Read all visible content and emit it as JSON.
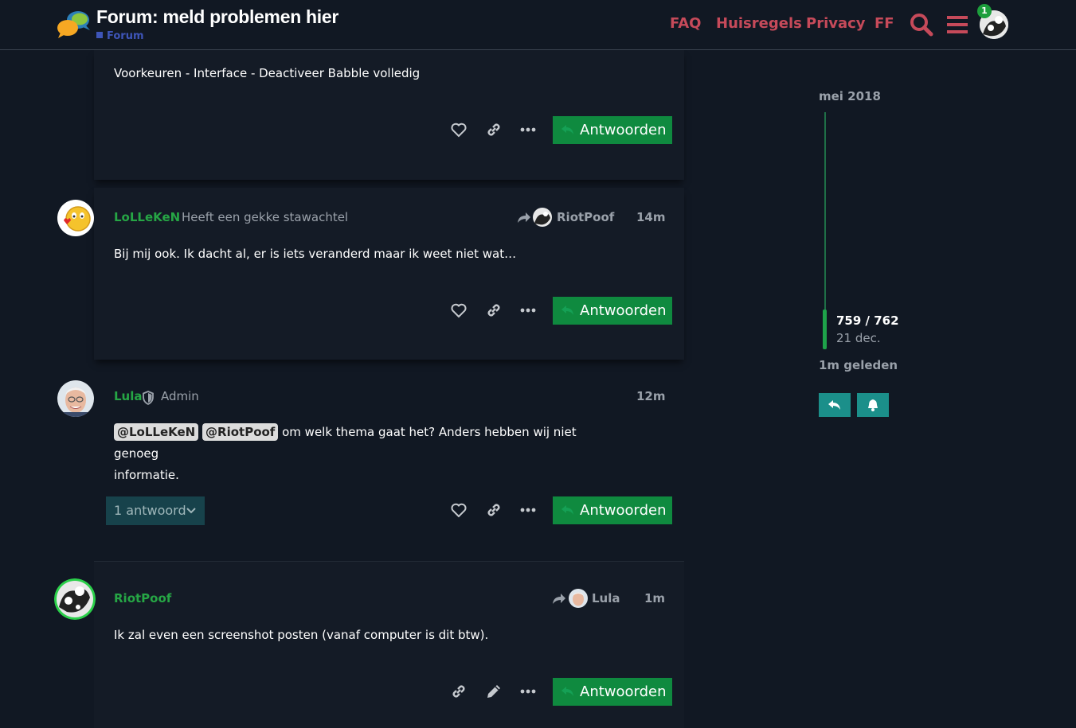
{
  "header": {
    "title": "Forum: meld problemen hier",
    "category": "Forum",
    "nav": [
      "FAQ",
      "Huisregels",
      "Privacy",
      "FF"
    ],
    "notification_count": "1",
    "accent_color": "#c64a5a"
  },
  "posts": [
    {
      "body": "Voorkeuren - Interface - Deactiveer Babble volledig",
      "reply_label": "Antwoorden"
    },
    {
      "username": "LoLLeKeN",
      "user_title": "Heeft een gekke stawachtel",
      "reply_to": "RiotPoof",
      "time": "14m",
      "body": "Bij mij ook. Ik dacht al, er is iets veranderd maar ik weet niet wat…",
      "reply_label": "Antwoorden"
    },
    {
      "username": "Lula",
      "user_title": "Admin",
      "time": "12m",
      "mentions": [
        "@LoLLeKeN",
        "@RiotPoof"
      ],
      "body_rest": "om welk thema gaat het? Anders hebben wij niet genoeg",
      "body_line2": "informatie.",
      "replies_label": "1 antwoord",
      "reply_label": "Antwoorden"
    },
    {
      "username": "RiotPoof",
      "reply_to": "Lula",
      "time": "1m",
      "body": "Ik zal even een screenshot posten (vanaf computer is dit btw).",
      "reply_label": "Antwoorden"
    }
  ],
  "timeline": {
    "start": "mei 2018",
    "position": "759 / 762",
    "date": "21 dec.",
    "end": "1m geleden"
  },
  "colors": {
    "background": "#111823",
    "username": "#26a645",
    "reply_button": "#0f8a3f",
    "timeline_button": "#1b8f8a"
  }
}
